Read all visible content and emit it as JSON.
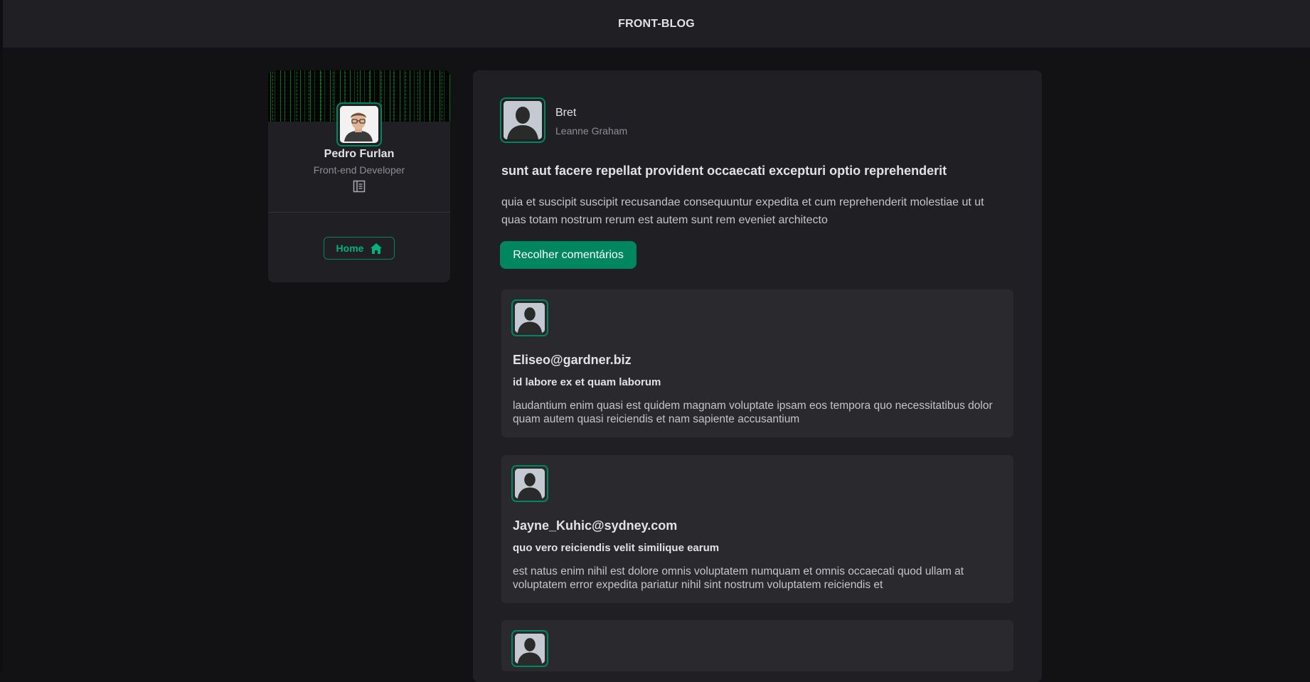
{
  "header": {
    "title": "FRONT-BLOG"
  },
  "profile": {
    "name": "Pedro Furlan",
    "role": "Front-end Developer",
    "link_icon": "document-icon",
    "home_label": "Home",
    "home_icon": "home-icon"
  },
  "post": {
    "author_username": "Bret",
    "author_name": "Leanne Graham",
    "title": "sunt aut facere repellat provident occaecati excepturi optio reprehenderit",
    "body": "quia et suscipit suscipit recusandae consequuntur expedita et cum reprehenderit molestiae ut ut quas totam nostrum rerum est autem sunt rem eveniet architecto",
    "toggle_comments_label": "Recolher comentários"
  },
  "comments": [
    {
      "email": "Eliseo@gardner.biz",
      "name": "id labore ex et quam laborum",
      "body": "laudantium enim quasi est quidem magnam voluptate ipsam eos tempora quo necessitatibus dolor quam autem quasi reiciendis et nam sapiente accusantium"
    },
    {
      "email": "Jayne_Kuhic@sydney.com",
      "name": "quo vero reiciendis velit similique earum",
      "body": "est natus enim nihil est dolore omnis voluptatem numquam et omnis occaecati quod ullam at voluptatem error expedita pariatur nihil sint nostrum voluptatem reiciendis et"
    },
    {
      "email": "",
      "name": "",
      "body": ""
    }
  ],
  "colors": {
    "background": "#121214",
    "surface": "#202024",
    "comment_surface": "#29292e",
    "accent": "#00875f",
    "accent_text": "#00b37e"
  }
}
